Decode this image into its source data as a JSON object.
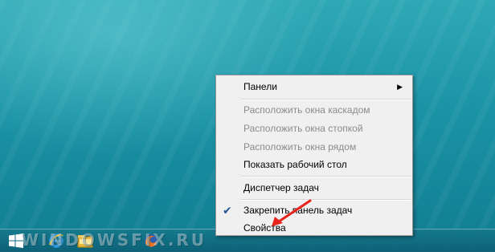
{
  "context_menu": {
    "items": [
      {
        "label": "Панели",
        "has_submenu": true,
        "enabled": true
      },
      {
        "label": "Расположить окна каскадом",
        "enabled": false
      },
      {
        "label": "Расположить окна стопкой",
        "enabled": false
      },
      {
        "label": "Расположить окна рядом",
        "enabled": false
      },
      {
        "label": "Показать рабочий стол",
        "enabled": true
      },
      {
        "label": "Диспетчер задач",
        "enabled": true
      },
      {
        "label": "Закрепить панель задач",
        "enabled": true,
        "checked": true
      },
      {
        "label": "Свойства",
        "enabled": true
      }
    ],
    "submenu_arrow": "▶",
    "check_mark": "✔"
  },
  "taskbar": {
    "icons": [
      "windows-start-icon",
      "internet-explorer-icon",
      "file-explorer-icon",
      "firefox-icon"
    ]
  },
  "watermark": "WINDOWSFIX.RU",
  "colors": {
    "desktop": "#1a93a5",
    "menu_background": "#f0f0f0",
    "disabled_text": "#8b8b8b",
    "arrow": "#e8231c"
  }
}
